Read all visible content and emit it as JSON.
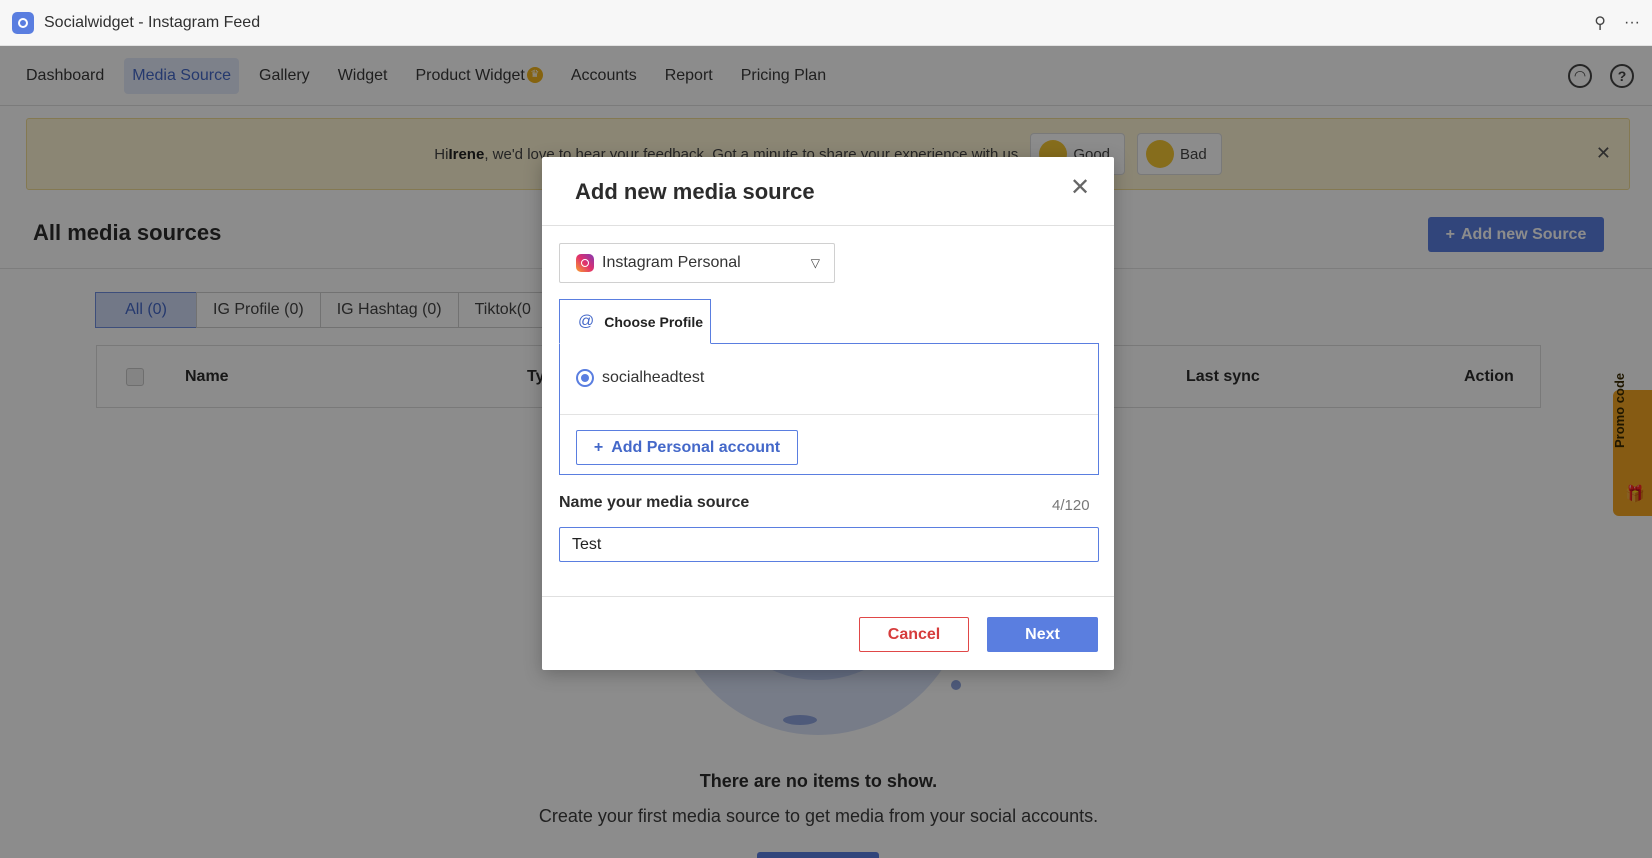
{
  "window": {
    "title": "Socialwidget - Instagram Feed",
    "pin_icon": "pin-icon",
    "more_label": "···"
  },
  "nav": {
    "items": [
      "Dashboard",
      "Media Source",
      "Gallery",
      "Widget",
      "Product Widget",
      "Accounts",
      "Report",
      "Pricing Plan"
    ],
    "active": "Media Source",
    "support_icon": "headset-icon",
    "help_label": "?"
  },
  "banner": {
    "greeting": "Hi ",
    "user": "Irene",
    "message": ", we'd love to hear your feedback. Got a minute to share your experience with us",
    "good_label": "Good",
    "bad_label": "Bad",
    "close_label": "✕"
  },
  "page": {
    "title": "All media sources",
    "add_source_label": "Add new Source"
  },
  "filters": [
    "All (0)",
    "IG Profile (0)",
    "IG Hashtag (0)",
    "Tiktok(0"
  ],
  "table": {
    "columns": {
      "name": "Name",
      "type": "Ty",
      "last_sync": "Last sync",
      "action": "Action"
    }
  },
  "empty": {
    "title": "There are no items to show.",
    "subtitle": "Create your first media source to get media from your social accounts."
  },
  "promo": {
    "label": "Promo code"
  },
  "modal": {
    "title": "Add new media source",
    "close_label": "✕",
    "source_type": "Instagram Personal",
    "choose_tab": "Choose Profile",
    "at_symbol": "@",
    "profile": "socialheadtest",
    "add_account_label": "Add Personal account",
    "name_label": "Name your media source",
    "name_count": "4/120",
    "name_value": "Test",
    "cancel_label": "Cancel",
    "next_label": "Next"
  },
  "colors": {
    "accent": "#5a7ee0",
    "danger": "#d63c3c",
    "banner_bg": "#fdf4d4",
    "promo": "#f5a623"
  }
}
